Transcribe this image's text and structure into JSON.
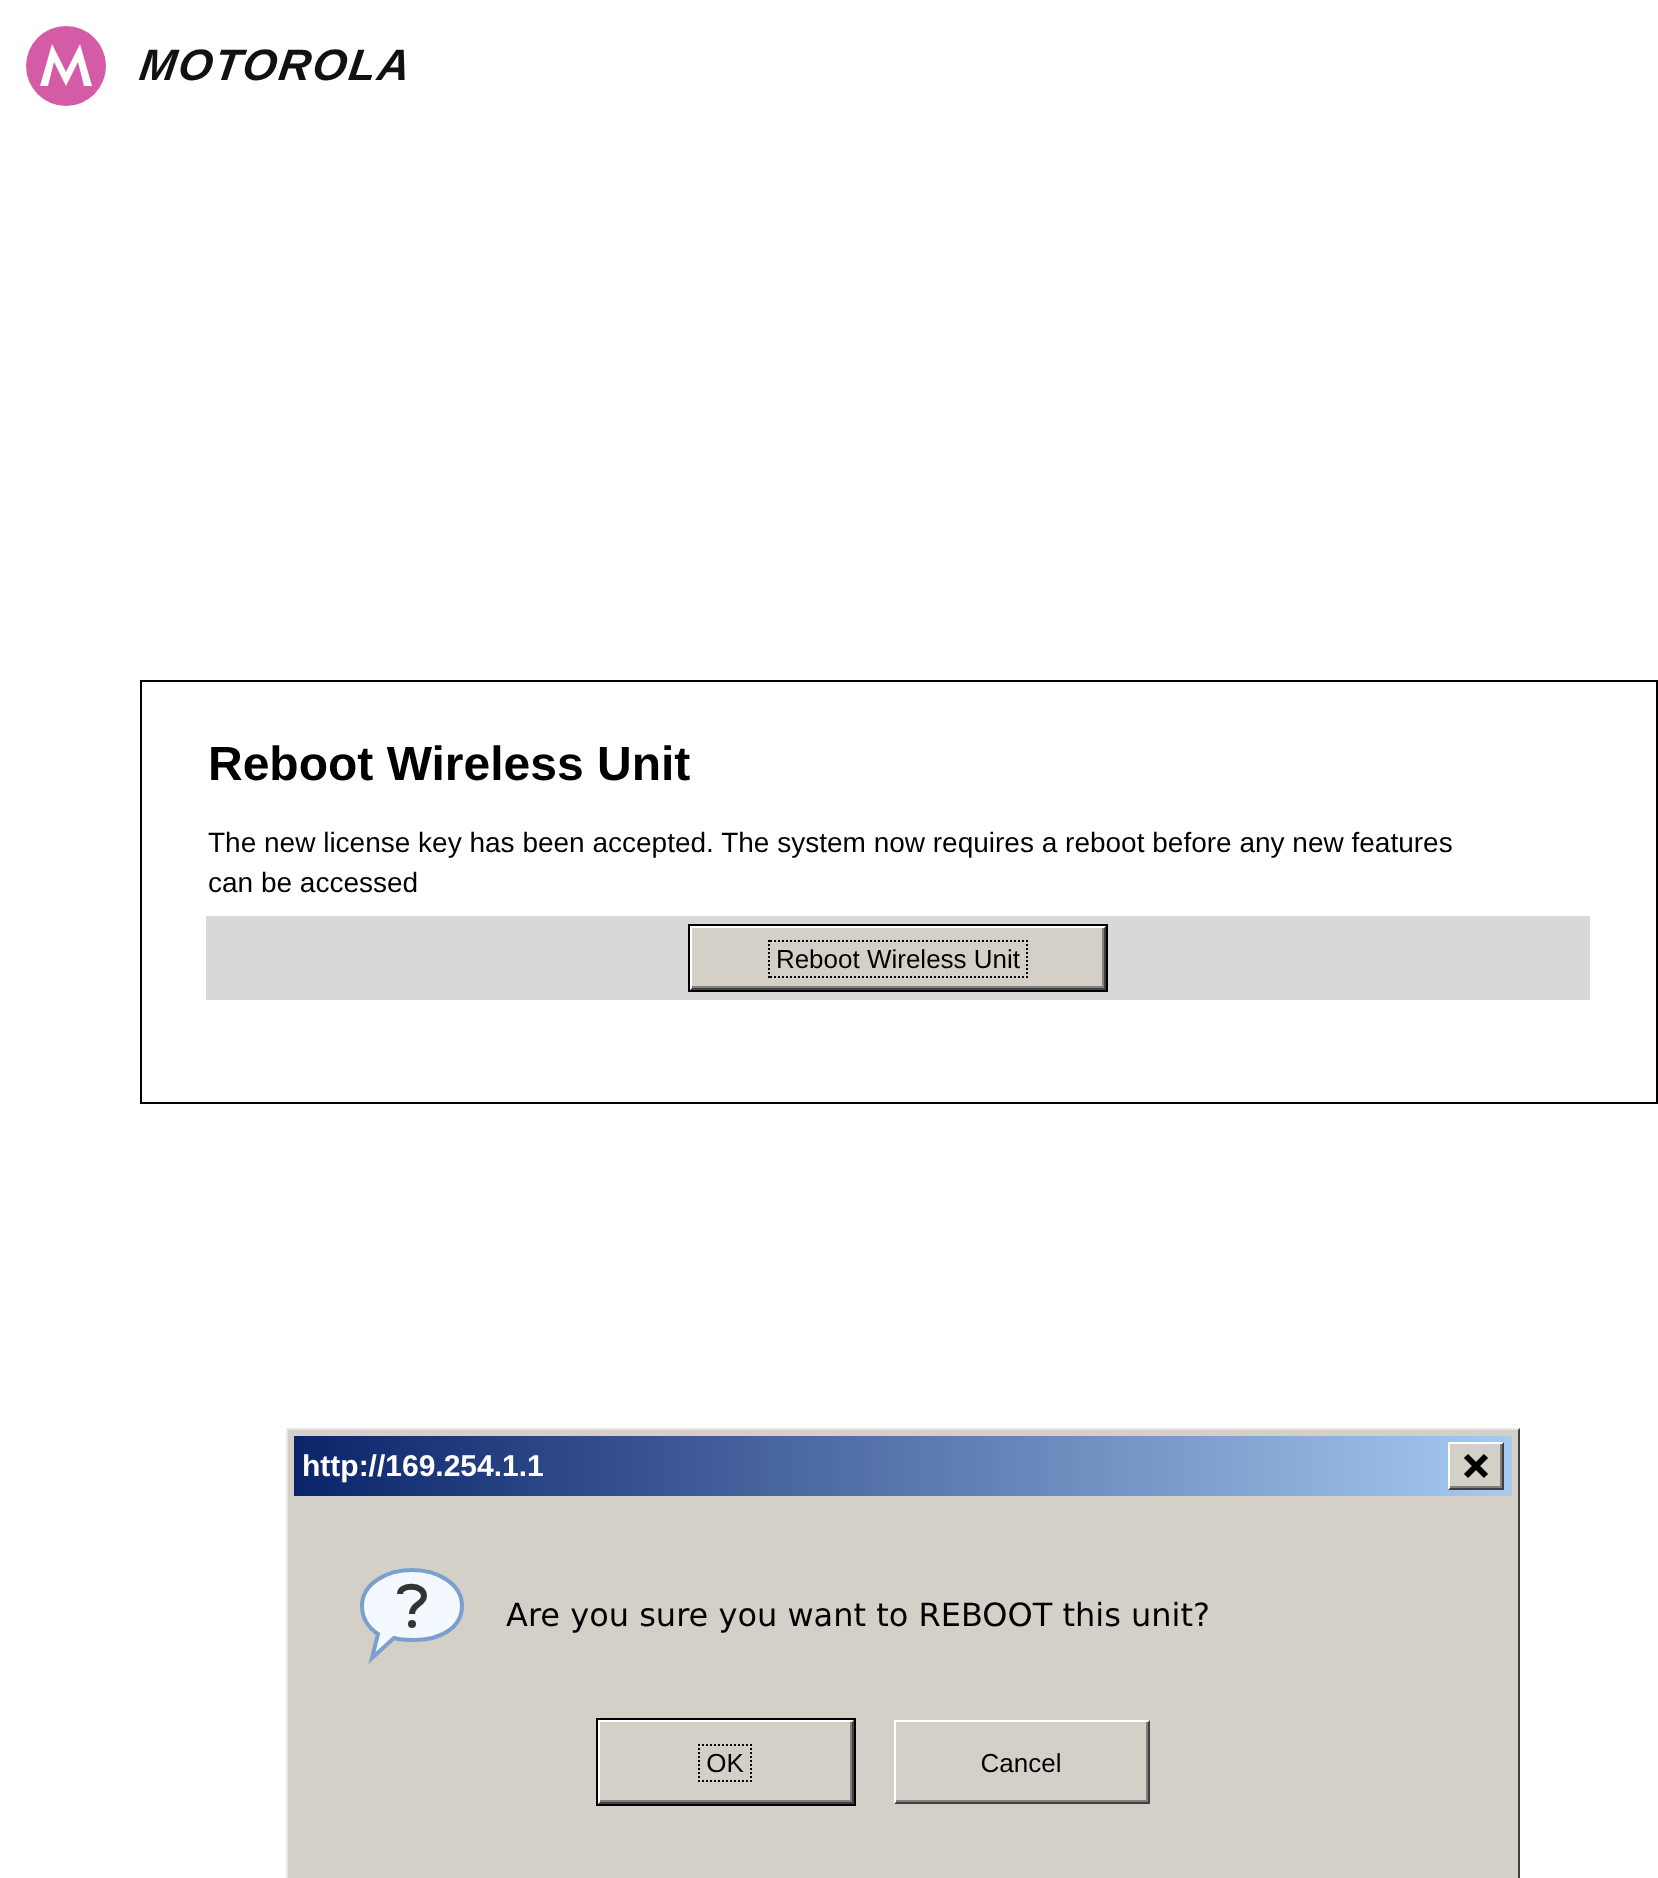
{
  "logo": {
    "wordmark": "MOTOROLA"
  },
  "reboot_panel": {
    "heading": "Reboot Wireless Unit",
    "message": "The new license key has been accepted. The system now requires a reboot before any new features can be accessed",
    "button": {
      "label": "Reboot Wireless Unit",
      "focused": true
    }
  },
  "dialog": {
    "title": "http://169.254.1.1",
    "message": "Are you sure you want to REBOOT this unit?",
    "buttons": [
      {
        "label": "OK",
        "focused": true
      },
      {
        "label": "Cancel",
        "focused": false
      }
    ]
  }
}
